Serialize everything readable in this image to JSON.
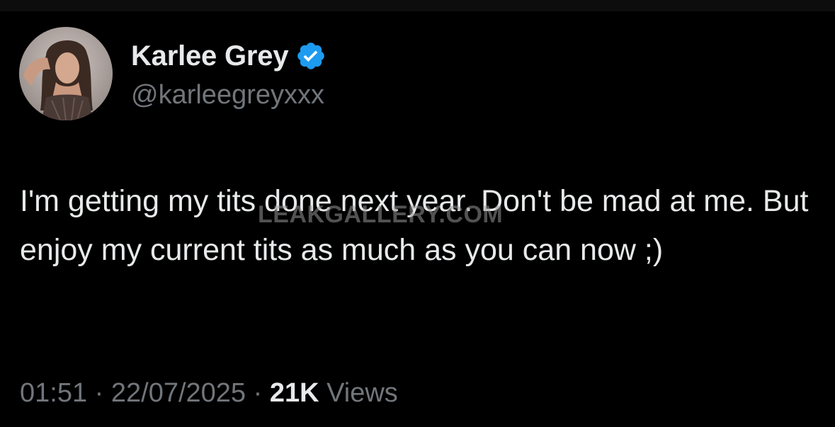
{
  "author": {
    "display_name": "Karlee Grey",
    "handle": "@karleegreyxxx",
    "verified_icon": "verified-badge-icon",
    "avatar_icon": "profile-photo"
  },
  "tweet": {
    "text": "I'm getting my tits done next year. Don't be mad at me. But enjoy my current tits as much as you can now ;)"
  },
  "meta": {
    "time": "01:51",
    "separator": "·",
    "date": "22/07/2025",
    "views_count": "21K",
    "views_label": "Views"
  },
  "watermark": {
    "text": "LEAKGALLERY.COM"
  },
  "colors": {
    "background": "#000000",
    "text_primary": "#e7e9ea",
    "text_secondary": "#71767b",
    "verified": "#1d9bf0"
  }
}
